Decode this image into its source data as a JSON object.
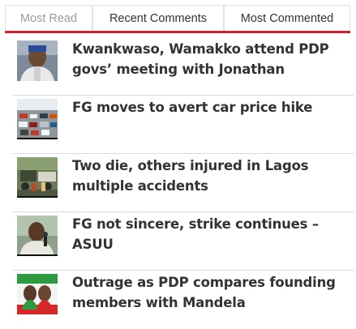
{
  "tabs": [
    {
      "label": "Most Read",
      "active": true
    },
    {
      "label": "Recent Comments",
      "active": false
    },
    {
      "label": "Most Commented",
      "active": false
    }
  ],
  "articles": [
    {
      "headline": "Kwankwaso, Wamakko attend PDP govs’ meeting with Jonathan",
      "thumbnail": "portrait-photo"
    },
    {
      "headline": "FG moves to avert car price hike",
      "thumbnail": "car-lot-photo"
    },
    {
      "headline": "Two die, others injured in Lagos multiple accidents",
      "thumbnail": "accident-scene-photo"
    },
    {
      "headline": "FG not sincere, strike continues – ASUU",
      "thumbnail": "man-speaking-photo"
    },
    {
      "headline": "Outrage as PDP compares founding members with Mandela",
      "thumbnail": "campaign-banner-photo"
    }
  ],
  "colors": {
    "accent": "#d3222a",
    "headline": "#333333",
    "divider": "#dadada"
  }
}
